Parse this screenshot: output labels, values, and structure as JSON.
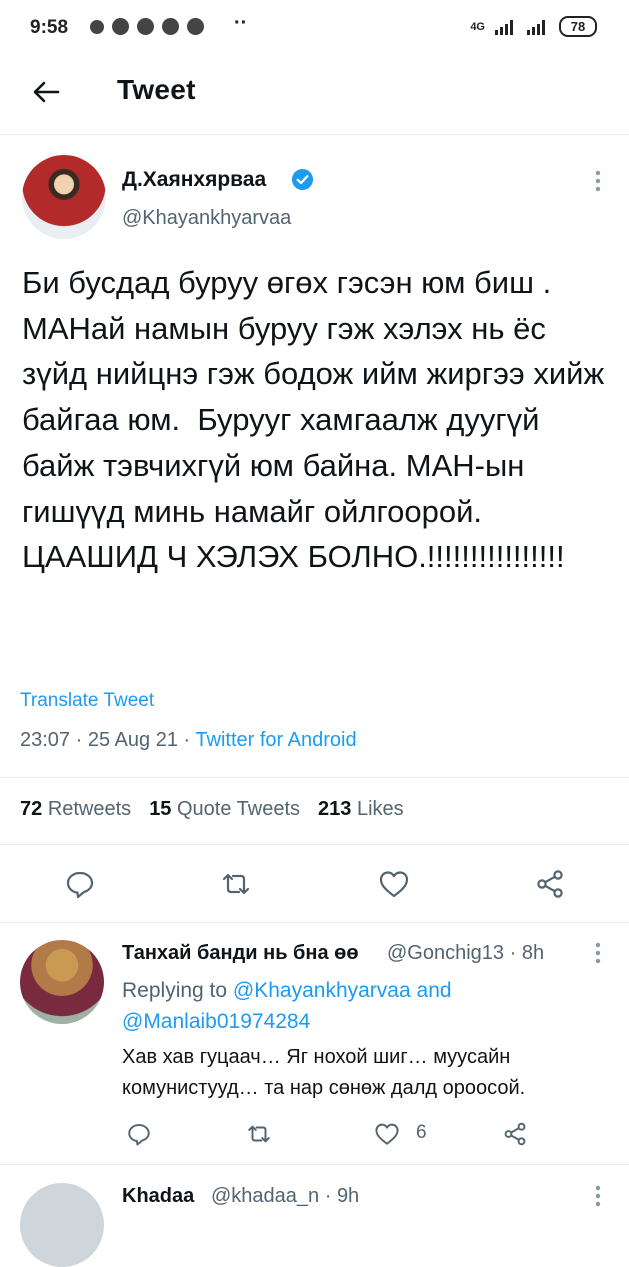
{
  "status_bar": {
    "time": "9:58",
    "more": "··",
    "network": "4G",
    "battery": "78"
  },
  "header": {
    "title": "Tweet"
  },
  "tweet": {
    "author_name": "Д.Хаянхярваа",
    "author_handle": "@Khayankhyarvaa",
    "text": "Би бусдад буруу өгөх гэсэн юм биш . МАНай намын буруу гэж хэлэх нь ёс зүйд нийцнэ гэж бодож ийм жиргээ хийж байгаа юм.  Бурууг хамгаалж дуугүй байж тэвчихгүй юм байна. МАН-ын гишүүд минь намайг ойлгоорой. ЦААШИД Ч ХЭЛЭХ БОЛНО.!!!!!!!!!!!!!!!!",
    "translate": "Translate Tweet",
    "time": "23:07",
    "date": "25 Aug 21",
    "source": "Twitter for Android",
    "sep": "·",
    "retweets_count": "72",
    "retweets_label": "Retweets",
    "quotes_count": "15",
    "quotes_label": "Quote Tweets",
    "likes_count": "213",
    "likes_label": "Likes"
  },
  "replies": [
    {
      "name": "Танхай банди нь бна өө",
      "handle_time": "@Gonchig13 · 8h",
      "replying_prefix": "Replying to",
      "mention1": "@Khayankhyarvaa",
      "and_word": "and",
      "mention2": "@Manlaib01974284",
      "text": "Хав хав гуцаач… Яг нохой шиг… муусайн комунистууд… та нар сөнөж далд ороосой.",
      "like_count": "6"
    },
    {
      "name": "Khadaa",
      "handle_time": "@khadaa_n · 9h"
    }
  ],
  "colors": {
    "accent": "#1d9bf0",
    "text": "#0f1419",
    "secondary": "#536471",
    "divider": "#e6ecf0"
  },
  "icons": {
    "back": "arrow-left",
    "verified": "verified-badge",
    "more": "kebab",
    "reply": "speech-bubble",
    "retweet": "retweet-arrows",
    "like": "heart",
    "share": "share-nodes"
  }
}
